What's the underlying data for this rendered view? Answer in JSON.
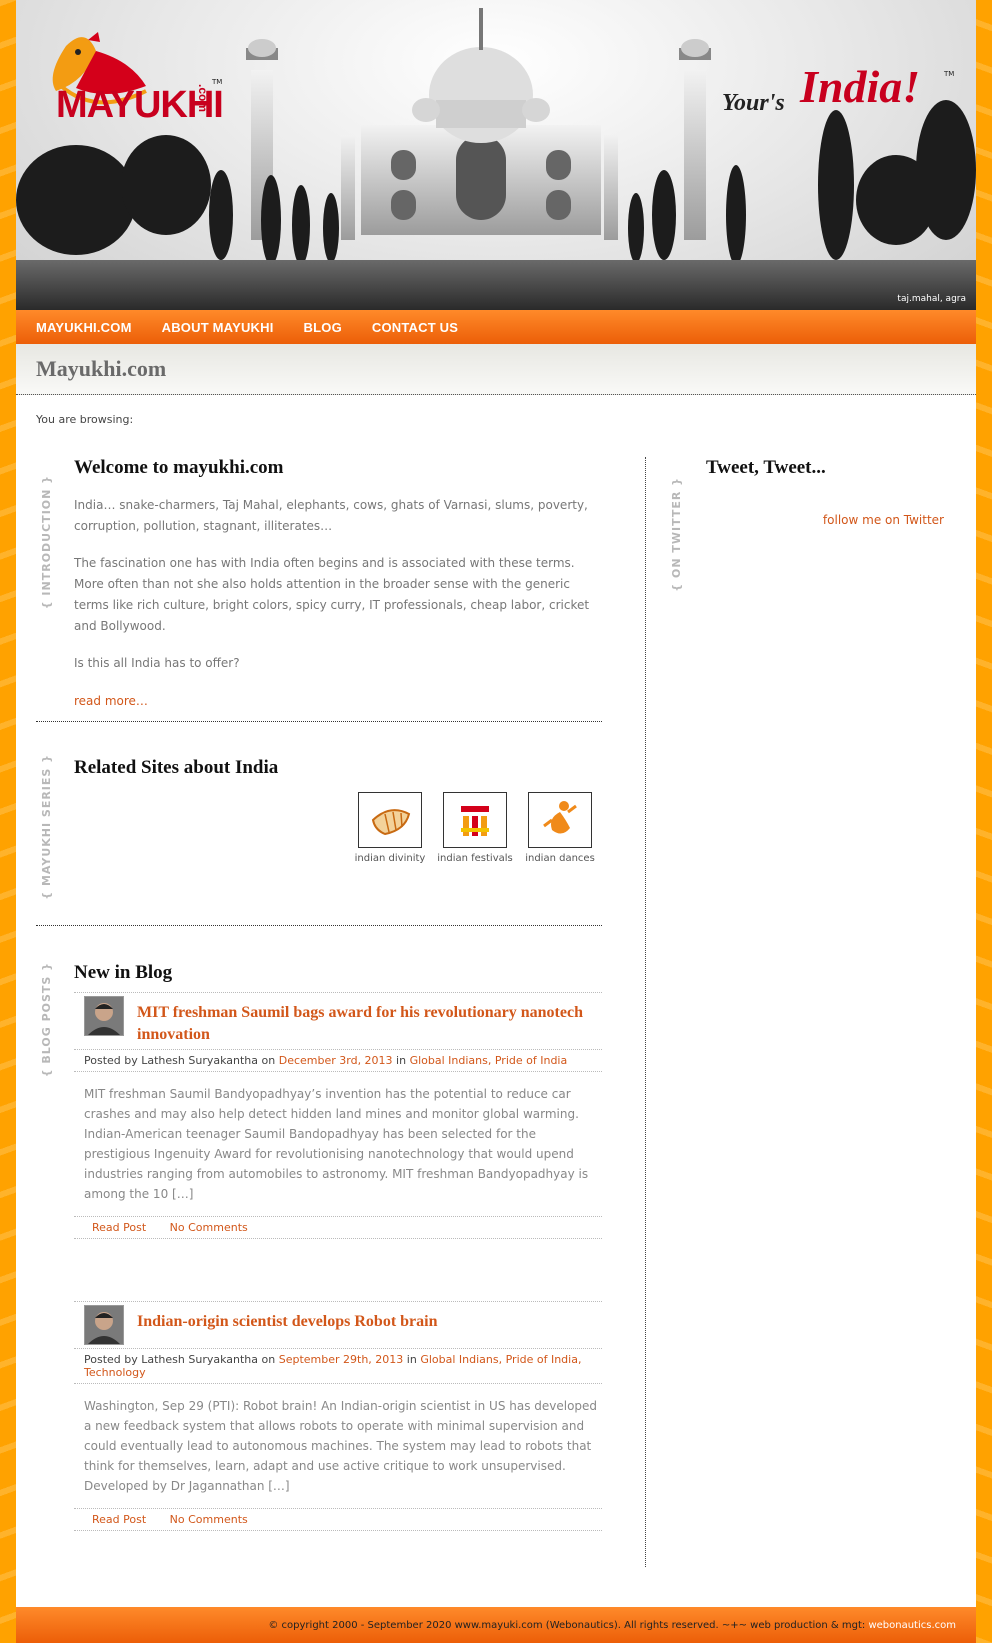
{
  "header": {
    "logo_text": "MAYUKHI",
    "logo_suffix": ".com",
    "logo_tm": "TM",
    "tagline_small": "Your's",
    "tagline_big": "India!",
    "tagline_tm": "TM",
    "caption": "taj.mahal, agra"
  },
  "nav": {
    "items": [
      {
        "label": "MAYUKHI.COM"
      },
      {
        "label": "ABOUT MAYUKHI"
      },
      {
        "label": "BLOG"
      },
      {
        "label": "CONTACT US"
      }
    ]
  },
  "page": {
    "title": "Mayukhi.com",
    "breadcrumb": "You are browsing:"
  },
  "intro": {
    "label": "{ INTRODUCTION }",
    "heading": "Welcome to mayukhi.com",
    "p1": "India… snake-charmers, Taj Mahal, elephants, cows, ghats of Varnasi, slums, poverty, corruption, pollution, stagnant, illiterates…",
    "p2": "The fascination one has with India often begins and is associated with these terms. More often than not she also holds attention in the broader sense with the generic terms like rich culture, bright colors, spicy curry, IT professionals, cheap labor, cricket and Bollywood.",
    "p3": "Is this all India has to offer?",
    "read_more": "read more…"
  },
  "related": {
    "label": "{ MAYUKHI SERIES }",
    "heading": "Related Sites about India",
    "sites": [
      {
        "name": "indian divinity",
        "icon": "conch-icon"
      },
      {
        "name": "indian festivals",
        "icon": "festival-icon"
      },
      {
        "name": "indian dances",
        "icon": "dancer-icon"
      }
    ]
  },
  "blog": {
    "label": "{ BLOG POSTS }",
    "heading": "New in Blog",
    "posts": [
      {
        "title": "MIT freshman Saumil bags award for his revolutionary nanotech innovation",
        "posted_by": "Posted by Lathesh Suryakantha on ",
        "date": "December 3rd, 2013",
        "in": " in ",
        "cats": "Global Indians, Pride of India",
        "excerpt": "MIT freshman Saumil Bandyopadhyay’s invention has the potential to reduce car crashes and may also help detect hidden land mines and monitor global warming. Indian-American teenager Saumil Bandopadhyay has been selected for the prestigious Ingenuity Award for revolutionising nanotechnology that would upend industries ranging from automobiles to astronomy. MIT freshman Bandyopadhyay is among the 10 […]",
        "read": "Read Post",
        "comments": "No Comments"
      },
      {
        "title": "Indian-origin scientist develops Robot brain",
        "posted_by": "Posted by Lathesh Suryakantha on ",
        "date": "September 29th, 2013",
        "in": " in ",
        "cats": "Global Indians, Pride of India, Technology",
        "excerpt": "Washington, Sep 29 (PTI): Robot brain! An Indian-origin scientist in US has developed a new feedback system that allows robots to operate with minimal supervision and could eventually lead to autonomous machines. The system may lead to robots that think for themselves, learn, adapt and use active critique to work unsupervised. Developed by Dr Jagannathan […]",
        "read": "Read Post",
        "comments": "No Comments"
      }
    ]
  },
  "twitter": {
    "label": "{ ON TWITTER }",
    "heading": "Tweet, Tweet...",
    "follow": "follow me on Twitter"
  },
  "footer": {
    "text": "© copyright 2000 - September 2020 www.mayuki.com (Webonautics). All rights reserved. ~+~ web production & mgt: ",
    "link": "webonautics.com"
  },
  "colors": {
    "accent": "#d2571a",
    "nav_orange": "#ec5e08",
    "page_orange": "#ff9400"
  }
}
